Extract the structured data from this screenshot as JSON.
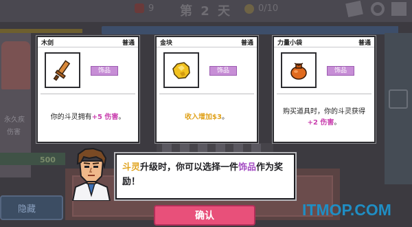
{
  "hud": {
    "day": "第 2 天",
    "item_count": "0/10",
    "hearts": "9"
  },
  "background": {
    "hide_button": "隐藏",
    "gold_value": "500",
    "left_text_1": "永久疾",
    "left_text_2": "伤害"
  },
  "cards": [
    {
      "name": "木剑",
      "rarity": "普通",
      "tag": "饰品",
      "icon": "wooden-sword-icon",
      "desc_pre": "你的斗灵拥有",
      "desc_hl": "+5 伤害",
      "desc_post": "。",
      "hl_class": "hl-pink"
    },
    {
      "name": "金块",
      "rarity": "普通",
      "tag": "饰品",
      "icon": "gold-nugget-icon",
      "desc_pre": "收入增加",
      "desc_hl": "$3",
      "desc_post": "。",
      "hl_class": "hl-gold",
      "pre_class": "hl-gold"
    },
    {
      "name": "力量小袋",
      "rarity": "普通",
      "tag": "饰品",
      "icon": "power-pouch-icon",
      "desc_pre": "购买道具时，你的斗灵获得",
      "desc_hl": "+2 伤害",
      "desc_post": "。",
      "hl_class": "hl-pink"
    }
  ],
  "dialog": {
    "part1": "斗灵",
    "part2": "升级时，你可以选择一件",
    "part3": "饰品",
    "part4": "作为奖励！"
  },
  "confirm_label": "确认",
  "watermark": "ITMOP.COM",
  "colors": {
    "confirm": "#e8507a",
    "tag": "#c78ed6",
    "highlight_pink": "#c93fae",
    "highlight_gold": "#e0a21c",
    "watermark": "#1f8ec4"
  }
}
